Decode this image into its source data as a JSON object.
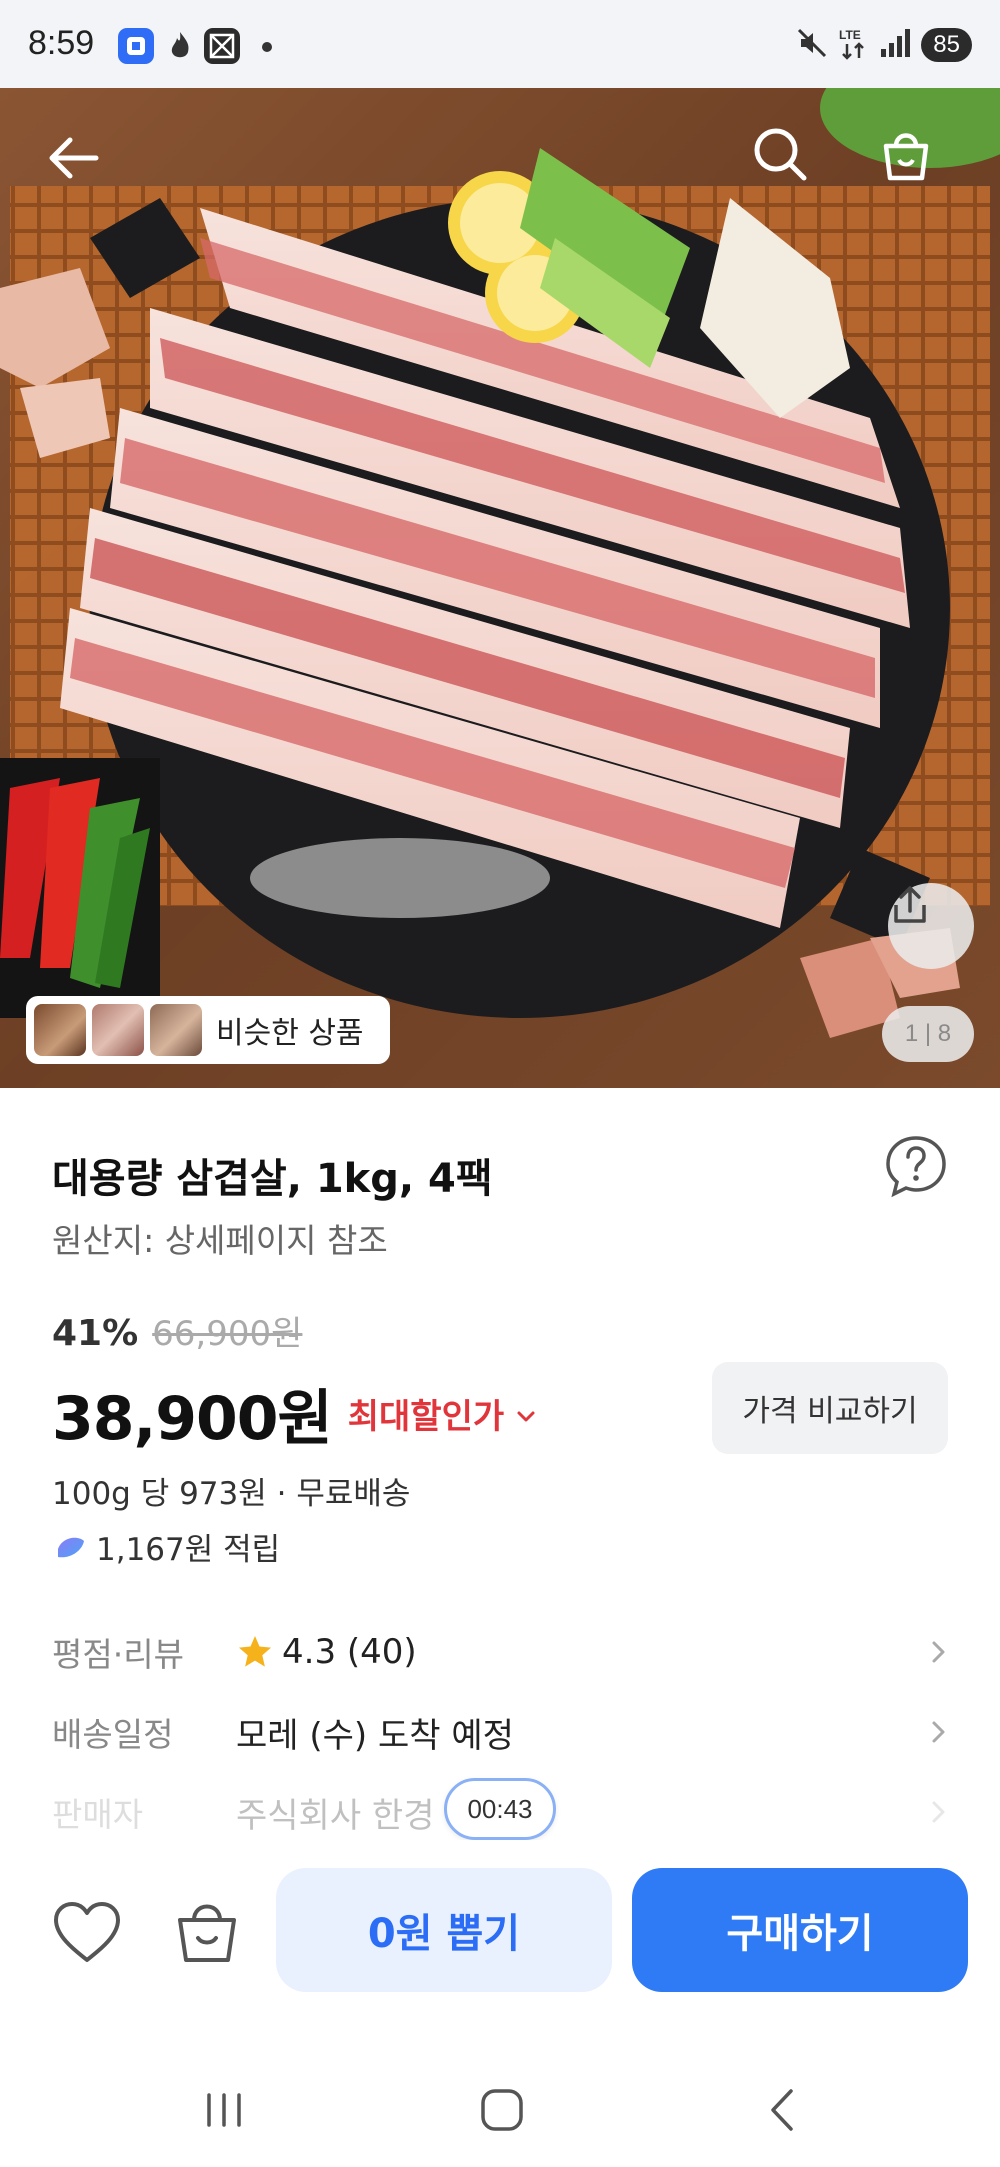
{
  "status_bar": {
    "time": "8:59",
    "battery": "85"
  },
  "hero": {
    "page_counter": "1 | 8",
    "similar_label": "비슷한 상품"
  },
  "product": {
    "title": "대용량 삼겹살, 1kg, 4팩",
    "origin": "원산지: 상세페이지 참조",
    "discount_rate": "41%",
    "original_price": "66,900원",
    "price": "38,900원",
    "max_discount_label": "최대할인가",
    "compare_label": "가격 비교하기",
    "unit_price": "100g 당 973원 · 무료배송",
    "points": "1,167원 적립"
  },
  "info": {
    "rating_label": "평점·리뷰",
    "rating_value": "4.3 (40)",
    "delivery_label": "배송일정",
    "delivery_value": "모레 (수) 도착 예정",
    "seller_label": "판매자",
    "seller_value": "주식회사 한경"
  },
  "timer": "00:43",
  "actions": {
    "draw_label": "0원 뽑기",
    "buy_label": "구매하기"
  },
  "colors": {
    "accent": "#2f7bf5",
    "sale_red": "#e0353b",
    "star": "#f5b21b"
  }
}
